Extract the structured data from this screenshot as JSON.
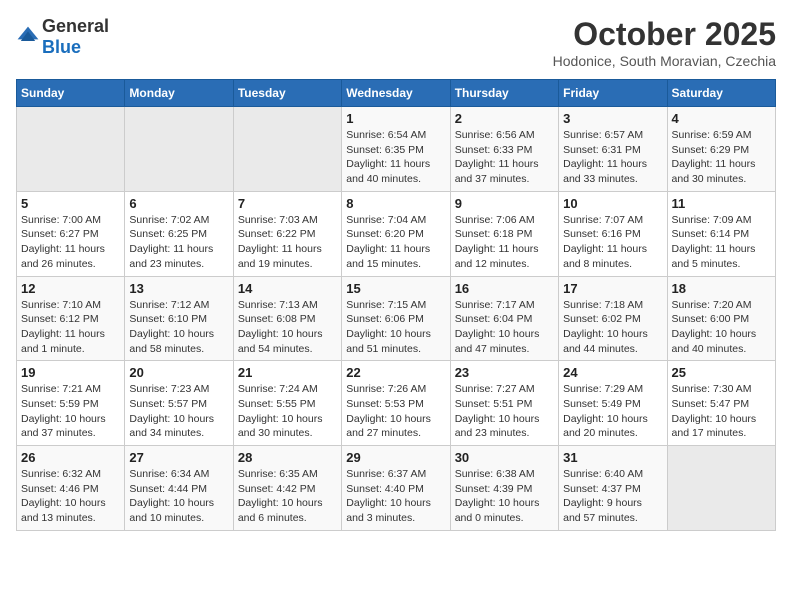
{
  "logo": {
    "general": "General",
    "blue": "Blue"
  },
  "header": {
    "month": "October 2025",
    "location": "Hodonice, South Moravian, Czechia"
  },
  "weekdays": [
    "Sunday",
    "Monday",
    "Tuesday",
    "Wednesday",
    "Thursday",
    "Friday",
    "Saturday"
  ],
  "weeks": [
    [
      {
        "day": "",
        "info": ""
      },
      {
        "day": "",
        "info": ""
      },
      {
        "day": "",
        "info": ""
      },
      {
        "day": "1",
        "info": "Sunrise: 6:54 AM\nSunset: 6:35 PM\nDaylight: 11 hours\nand 40 minutes."
      },
      {
        "day": "2",
        "info": "Sunrise: 6:56 AM\nSunset: 6:33 PM\nDaylight: 11 hours\nand 37 minutes."
      },
      {
        "day": "3",
        "info": "Sunrise: 6:57 AM\nSunset: 6:31 PM\nDaylight: 11 hours\nand 33 minutes."
      },
      {
        "day": "4",
        "info": "Sunrise: 6:59 AM\nSunset: 6:29 PM\nDaylight: 11 hours\nand 30 minutes."
      }
    ],
    [
      {
        "day": "5",
        "info": "Sunrise: 7:00 AM\nSunset: 6:27 PM\nDaylight: 11 hours\nand 26 minutes."
      },
      {
        "day": "6",
        "info": "Sunrise: 7:02 AM\nSunset: 6:25 PM\nDaylight: 11 hours\nand 23 minutes."
      },
      {
        "day": "7",
        "info": "Sunrise: 7:03 AM\nSunset: 6:22 PM\nDaylight: 11 hours\nand 19 minutes."
      },
      {
        "day": "8",
        "info": "Sunrise: 7:04 AM\nSunset: 6:20 PM\nDaylight: 11 hours\nand 15 minutes."
      },
      {
        "day": "9",
        "info": "Sunrise: 7:06 AM\nSunset: 6:18 PM\nDaylight: 11 hours\nand 12 minutes."
      },
      {
        "day": "10",
        "info": "Sunrise: 7:07 AM\nSunset: 6:16 PM\nDaylight: 11 hours\nand 8 minutes."
      },
      {
        "day": "11",
        "info": "Sunrise: 7:09 AM\nSunset: 6:14 PM\nDaylight: 11 hours\nand 5 minutes."
      }
    ],
    [
      {
        "day": "12",
        "info": "Sunrise: 7:10 AM\nSunset: 6:12 PM\nDaylight: 11 hours\nand 1 minute."
      },
      {
        "day": "13",
        "info": "Sunrise: 7:12 AM\nSunset: 6:10 PM\nDaylight: 10 hours\nand 58 minutes."
      },
      {
        "day": "14",
        "info": "Sunrise: 7:13 AM\nSunset: 6:08 PM\nDaylight: 10 hours\nand 54 minutes."
      },
      {
        "day": "15",
        "info": "Sunrise: 7:15 AM\nSunset: 6:06 PM\nDaylight: 10 hours\nand 51 minutes."
      },
      {
        "day": "16",
        "info": "Sunrise: 7:17 AM\nSunset: 6:04 PM\nDaylight: 10 hours\nand 47 minutes."
      },
      {
        "day": "17",
        "info": "Sunrise: 7:18 AM\nSunset: 6:02 PM\nDaylight: 10 hours\nand 44 minutes."
      },
      {
        "day": "18",
        "info": "Sunrise: 7:20 AM\nSunset: 6:00 PM\nDaylight: 10 hours\nand 40 minutes."
      }
    ],
    [
      {
        "day": "19",
        "info": "Sunrise: 7:21 AM\nSunset: 5:59 PM\nDaylight: 10 hours\nand 37 minutes."
      },
      {
        "day": "20",
        "info": "Sunrise: 7:23 AM\nSunset: 5:57 PM\nDaylight: 10 hours\nand 34 minutes."
      },
      {
        "day": "21",
        "info": "Sunrise: 7:24 AM\nSunset: 5:55 PM\nDaylight: 10 hours\nand 30 minutes."
      },
      {
        "day": "22",
        "info": "Sunrise: 7:26 AM\nSunset: 5:53 PM\nDaylight: 10 hours\nand 27 minutes."
      },
      {
        "day": "23",
        "info": "Sunrise: 7:27 AM\nSunset: 5:51 PM\nDaylight: 10 hours\nand 23 minutes."
      },
      {
        "day": "24",
        "info": "Sunrise: 7:29 AM\nSunset: 5:49 PM\nDaylight: 10 hours\nand 20 minutes."
      },
      {
        "day": "25",
        "info": "Sunrise: 7:30 AM\nSunset: 5:47 PM\nDaylight: 10 hours\nand 17 minutes."
      }
    ],
    [
      {
        "day": "26",
        "info": "Sunrise: 6:32 AM\nSunset: 4:46 PM\nDaylight: 10 hours\nand 13 minutes."
      },
      {
        "day": "27",
        "info": "Sunrise: 6:34 AM\nSunset: 4:44 PM\nDaylight: 10 hours\nand 10 minutes."
      },
      {
        "day": "28",
        "info": "Sunrise: 6:35 AM\nSunset: 4:42 PM\nDaylight: 10 hours\nand 6 minutes."
      },
      {
        "day": "29",
        "info": "Sunrise: 6:37 AM\nSunset: 4:40 PM\nDaylight: 10 hours\nand 3 minutes."
      },
      {
        "day": "30",
        "info": "Sunrise: 6:38 AM\nSunset: 4:39 PM\nDaylight: 10 hours\nand 0 minutes."
      },
      {
        "day": "31",
        "info": "Sunrise: 6:40 AM\nSunset: 4:37 PM\nDaylight: 9 hours\nand 57 minutes."
      },
      {
        "day": "",
        "info": ""
      }
    ]
  ]
}
